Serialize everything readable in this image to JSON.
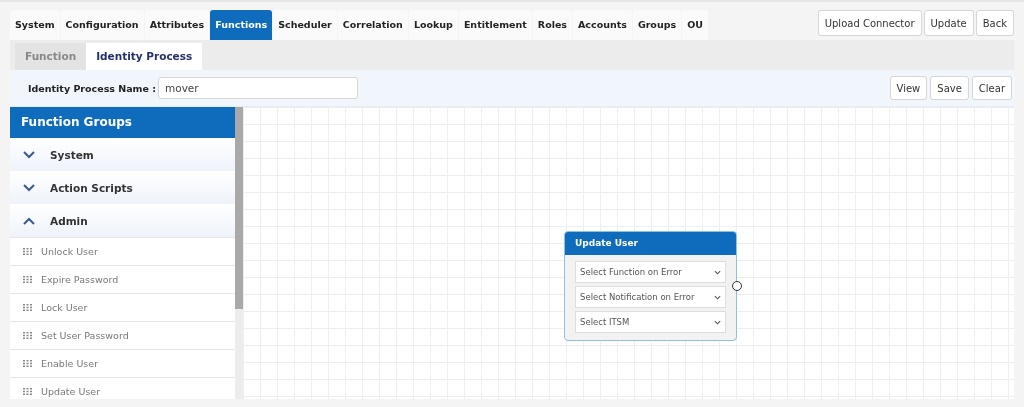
{
  "tabs": [
    {
      "label": "System",
      "selected": false
    },
    {
      "label": "Configuration",
      "selected": false
    },
    {
      "label": "Attributes",
      "selected": false
    },
    {
      "label": "Functions",
      "selected": true
    },
    {
      "label": "Scheduler",
      "selected": false
    },
    {
      "label": "Correlation",
      "selected": false
    },
    {
      "label": "Lookup",
      "selected": false
    },
    {
      "label": "Entitlement",
      "selected": false
    },
    {
      "label": "Roles",
      "selected": false
    },
    {
      "label": "Accounts",
      "selected": false
    },
    {
      "label": "Groups",
      "selected": false
    },
    {
      "label": "OU",
      "selected": false
    }
  ],
  "top_buttons": [
    "Upload Connector",
    "Update",
    "Back"
  ],
  "sub_tabs": [
    {
      "label": "Function",
      "selected": false
    },
    {
      "label": "Identity Process",
      "selected": true
    }
  ],
  "name_field": {
    "label": "Identity Process Name :",
    "value": "mover"
  },
  "action_buttons": [
    "View",
    "Save",
    "Clear"
  ],
  "sidebar": {
    "title": "Function Groups",
    "groups": [
      {
        "label": "System",
        "expanded": false
      },
      {
        "label": "Action Scripts",
        "expanded": false
      },
      {
        "label": "Admin",
        "expanded": true,
        "children": [
          {
            "label": "Unlock User"
          },
          {
            "label": "Expire Password"
          },
          {
            "label": "Lock User"
          },
          {
            "label": "Set User Password"
          },
          {
            "label": "Enable User"
          },
          {
            "label": "Update User"
          }
        ]
      }
    ]
  },
  "node": {
    "title": "Update User",
    "selects": [
      "Select Function on Error",
      "Select Notification on Error",
      "Select ITSM"
    ]
  }
}
